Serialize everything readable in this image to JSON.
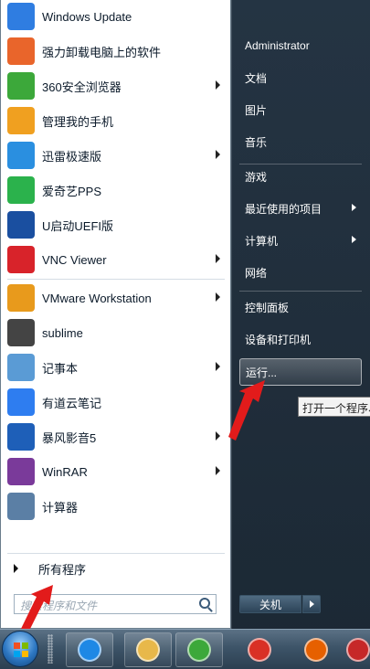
{
  "programs": [
    {
      "label": "Windows Update",
      "icon": "windows-update-icon",
      "color": "#2f7de1",
      "arrow": false
    },
    {
      "label": "强力卸载电脑上的软件",
      "icon": "uninstaller-icon",
      "color": "#e9652b",
      "arrow": false
    },
    {
      "label": "360安全浏览器",
      "icon": "360-browser-icon",
      "color": "#3ca83a",
      "arrow": true
    },
    {
      "label": "管理我的手机",
      "icon": "phone-manager-icon",
      "color": "#f0a020",
      "arrow": false
    },
    {
      "label": "迅雷极速版",
      "icon": "thunder-icon",
      "color": "#2a8fe0",
      "arrow": true
    },
    {
      "label": "爱奇艺PPS",
      "icon": "iqiyi-icon",
      "color": "#2bb24c",
      "arrow": false
    },
    {
      "label": "U启动UEFI版",
      "icon": "u-boot-icon",
      "color": "#1a4fa0",
      "arrow": false
    },
    {
      "label": "VNC Viewer",
      "icon": "vnc-icon",
      "color": "#d8232a",
      "arrow": true
    },
    {
      "label": "VMware Workstation",
      "icon": "vmware-icon",
      "color": "#e89a1c",
      "arrow": true
    },
    {
      "label": "sublime",
      "icon": "sublime-icon",
      "color": "#444444",
      "arrow": false
    },
    {
      "label": "记事本",
      "icon": "notepad-icon",
      "color": "#5a9bd5",
      "arrow": true
    },
    {
      "label": "有道云笔记",
      "icon": "youdao-note-icon",
      "color": "#2e7df0",
      "arrow": false
    },
    {
      "label": "暴风影音5",
      "icon": "baofeng-icon",
      "color": "#1e5fb8",
      "arrow": true
    },
    {
      "label": "WinRAR",
      "icon": "winrar-icon",
      "color": "#7a3a9a",
      "arrow": true
    },
    {
      "label": "计算器",
      "icon": "calculator-icon",
      "color": "#5b7fa5",
      "arrow": false
    }
  ],
  "all_programs_label": "所有程序",
  "search_placeholder": "搜索程序和文件",
  "right_items": [
    {
      "label": "Administrator",
      "arrow": false
    },
    {
      "label": "文档",
      "arrow": false
    },
    {
      "label": "图片",
      "arrow": false
    },
    {
      "label": "音乐",
      "arrow": false
    },
    {
      "label": "游戏",
      "arrow": false
    },
    {
      "label": "最近使用的项目",
      "arrow": true
    },
    {
      "label": "计算机",
      "arrow": true
    },
    {
      "label": "网络",
      "arrow": false
    },
    {
      "label": "控制面板",
      "arrow": false
    },
    {
      "label": "设备和打印机",
      "arrow": false
    },
    {
      "label": "运行...",
      "arrow": false
    }
  ],
  "tooltip": "打开一个程序、",
  "shutdown_label": "关机",
  "taskbar_items": [
    {
      "name": "ie-icon",
      "color": "#1e88e5"
    },
    {
      "name": "explorer-icon",
      "color": "#e8b84a"
    },
    {
      "name": "360-browser-icon",
      "color": "#3ca83a"
    },
    {
      "name": "chrome-icon",
      "color": "#d93025"
    },
    {
      "name": "firefox-icon",
      "color": "#e66000"
    },
    {
      "name": "app-icon",
      "color": "#c62828"
    }
  ]
}
